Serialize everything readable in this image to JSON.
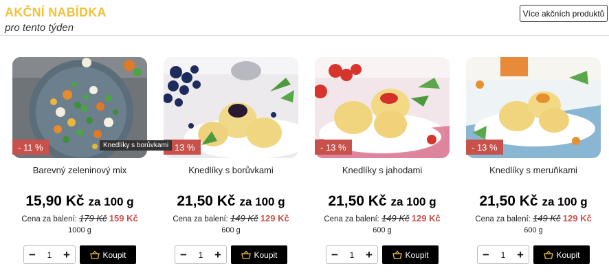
{
  "header": {
    "title": "AKČNÍ NABÍDKA",
    "subtitle": "pro tento týden",
    "more_button": "Více akčních produktů"
  },
  "labels": {
    "pack_prefix": "Cena za balení:",
    "buy": "Koupit"
  },
  "colors": {
    "accent_yellow": "#f0c23c",
    "discount_red": "#c8514b",
    "buy_button": "#000000"
  },
  "products": [
    {
      "name": "Barevný zeleninový mix",
      "discount": "- 11 %",
      "price": "15,90 Kč",
      "price_unit": "za 100 g",
      "old_price": "179 Kč",
      "new_price": "159 Kč",
      "weight": "1000 g",
      "quantity": "1",
      "image": "vegetable-mix-plate"
    },
    {
      "name": "Knedlíky s borůvkami",
      "discount": "- 13 %",
      "price": "21,50 Kč",
      "price_unit": "za 100 g",
      "old_price": "149 Kč",
      "new_price": "129 Kč",
      "weight": "600 g",
      "quantity": "1",
      "image": "blueberry-dumplings",
      "tooltip": "Knedlíky s borůvkami"
    },
    {
      "name": "Knedlíky s jahodami",
      "discount": "- 13 %",
      "price": "21,50 Kč",
      "price_unit": "za 100 g",
      "old_price": "149 Kč",
      "new_price": "129 Kč",
      "weight": "600 g",
      "quantity": "1",
      "image": "strawberry-dumplings"
    },
    {
      "name": "Knedlíky s meruňkami",
      "discount": "- 13 %",
      "price": "21,50 Kč",
      "price_unit": "za 100 g",
      "old_price": "149 Kč",
      "new_price": "129 Kč",
      "weight": "600 g",
      "quantity": "1",
      "image": "apricot-dumplings"
    }
  ]
}
